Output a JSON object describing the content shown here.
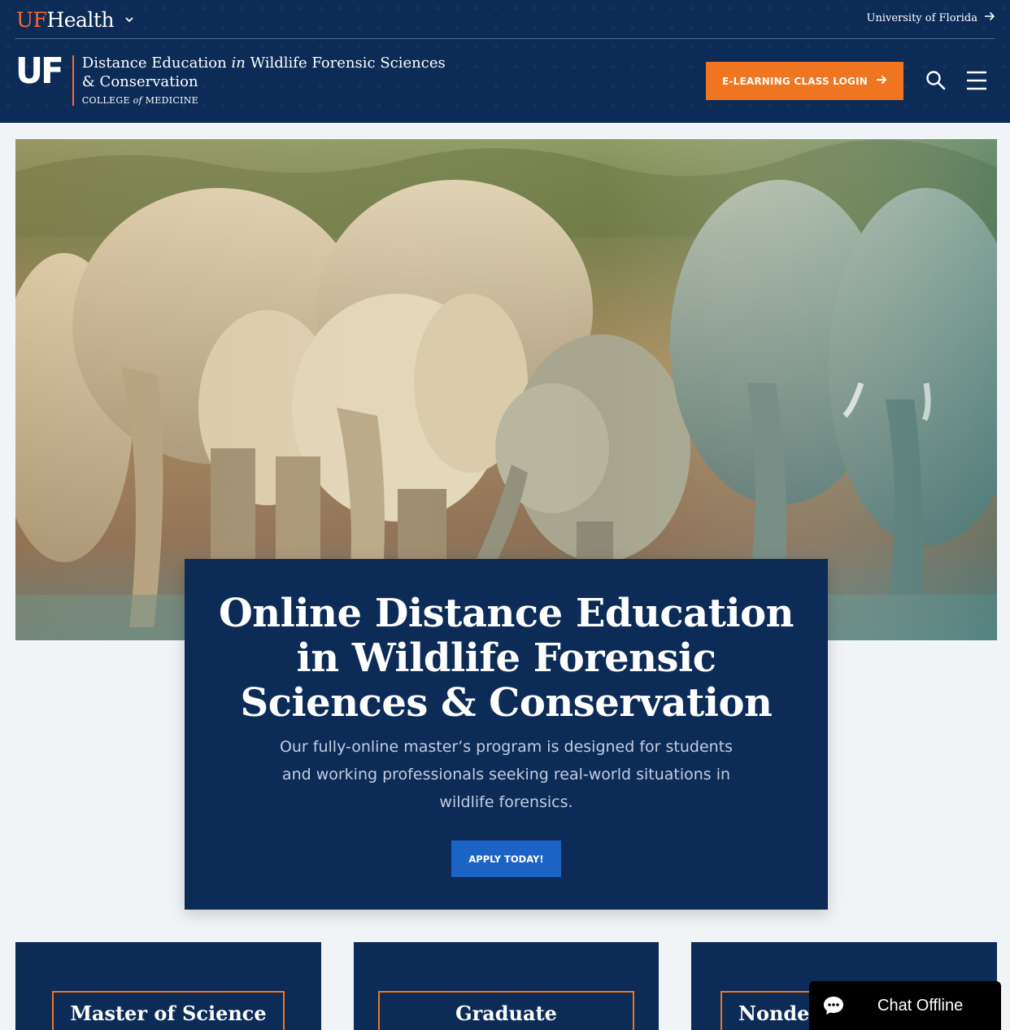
{
  "header": {
    "uf_health_prefix": "UF",
    "uf_health_suffix": "Health",
    "university_link": "University of Florida",
    "uf_mark": "UF",
    "title_part1": "Distance Education",
    "title_italic": "in",
    "title_part2": "Wildlife Forensic Sciences & Conservation",
    "college_pre": "COLLEGE",
    "college_italic": "of",
    "college_post": "MEDICINE",
    "elearning_button": "E-LEARNING CLASS LOGIN"
  },
  "hero": {
    "title": "Online Distance Education in Wildlife Forensic Sciences & Conservation",
    "description": "Our fully-online master’s program is designed for students and working professionals seeking real-world situations in wildlife forensics.",
    "apply_button": "APPLY TODAY!"
  },
  "programs": [
    {
      "label": "Master of Science"
    },
    {
      "label": "Graduate"
    },
    {
      "label": "Nonde"
    }
  ],
  "chat": {
    "label": "Chat Offline"
  },
  "colors": {
    "navy": "#0c2b57",
    "orange": "#f07520",
    "blue_button": "#1b64c5"
  }
}
